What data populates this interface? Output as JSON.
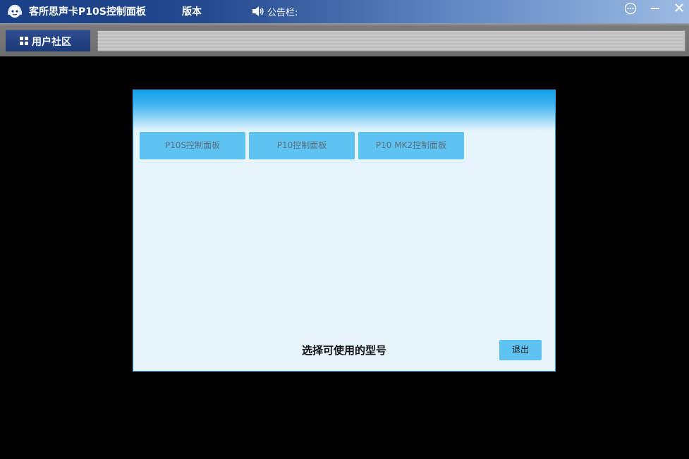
{
  "titlebar": {
    "app_title": "客所思声卡P10S控制面板",
    "menu_version": "版本",
    "notice_label": "公告栏:",
    "icons": {
      "logo": "headphone-mascot-icon",
      "speaker": "speaker-icon",
      "more": "more-circle-icon",
      "minimize": "minimize-icon",
      "close": "close-icon"
    }
  },
  "toolbar": {
    "community_tab_label": "用户社区",
    "community_icon": "grid-icon"
  },
  "dialog": {
    "model_buttons": [
      {
        "label": "P10S控制面板"
      },
      {
        "label": "P10控制面板"
      },
      {
        "label": "P10 MK2控制面板"
      }
    ],
    "prompt": "选择可使用的型号",
    "exit_label": "退出"
  },
  "colors": {
    "titlebar_start": "#1b3f86",
    "titlebar_end": "#9bbbe3",
    "dialog_bg": "#e6f5fc",
    "dialog_header": "#11a0eb",
    "button_bg": "#5ec3f0",
    "community_tab": "#1d3a78",
    "background": "#000000"
  }
}
